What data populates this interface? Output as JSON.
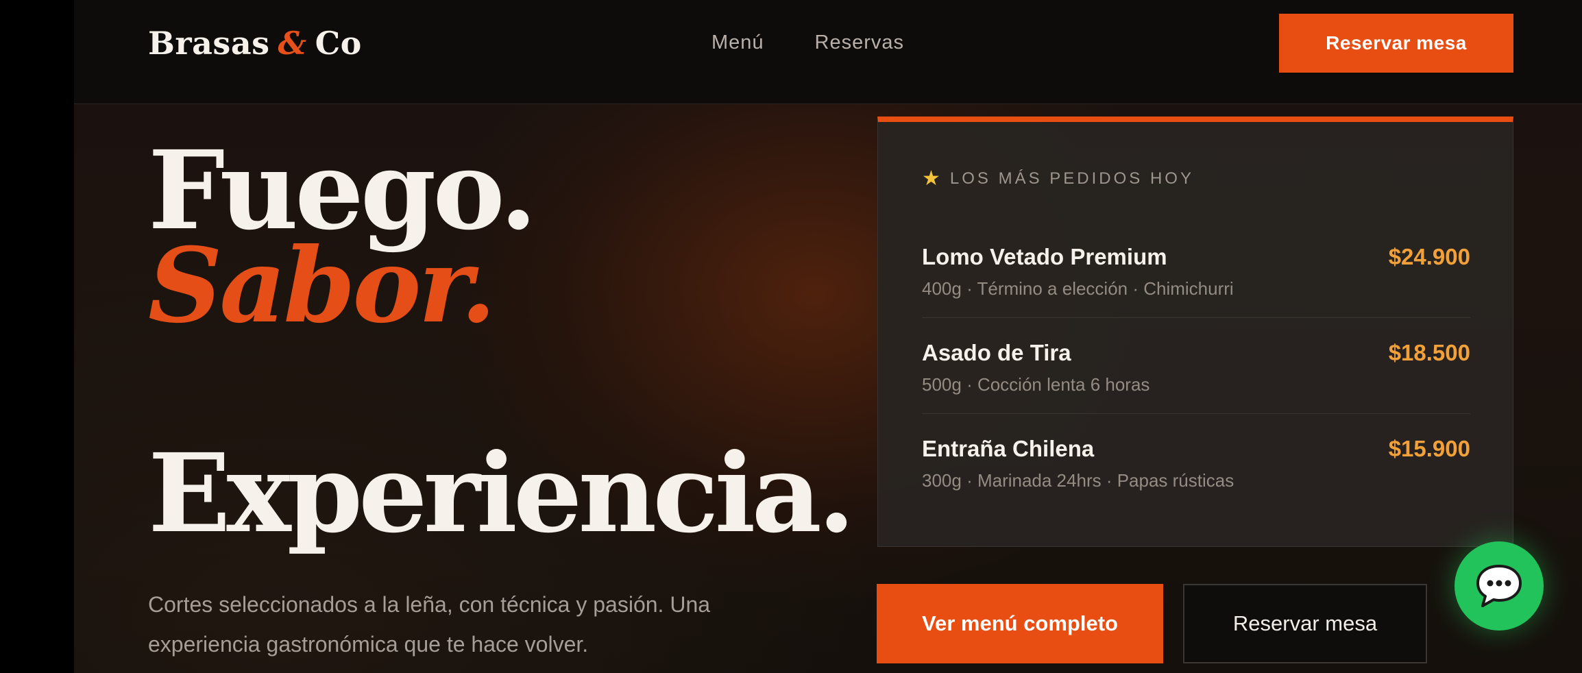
{
  "brand": {
    "name_part1": "Brasas",
    "ampersand": "&",
    "name_part2": "Co",
    "accent_color": "#e84e12"
  },
  "nav": {
    "links": [
      "Menú",
      "Reservas"
    ],
    "cta_label": "Reservar mesa"
  },
  "hero": {
    "line1": "Fuego.",
    "line2": "Sabor.",
    "line3": "Experiencia.",
    "description": "Cortes seleccionados a la leña, con técnica y pasión. Una experiencia gastronómica que te hace volver."
  },
  "popular_card": {
    "icon": "star-icon",
    "heading": "LOS MÁS PEDIDOS HOY",
    "dishes": [
      {
        "name": "Lomo Vetado Premium",
        "price": "$24.900",
        "meta": "400g · Término a elección · Chimichurri"
      },
      {
        "name": "Asado de Tira",
        "price": "$18.500",
        "meta": "500g · Cocción lenta 6 horas"
      },
      {
        "name": "Entraña Chilena",
        "price": "$15.900",
        "meta": "300g · Marinada 24hrs · Papas rústicas"
      }
    ]
  },
  "actions": {
    "primary_label": "Ver menú completo",
    "secondary_label": "Reservar mesa"
  },
  "chat": {
    "icon": "chat-bubble-icon",
    "color": "#23c35c"
  }
}
